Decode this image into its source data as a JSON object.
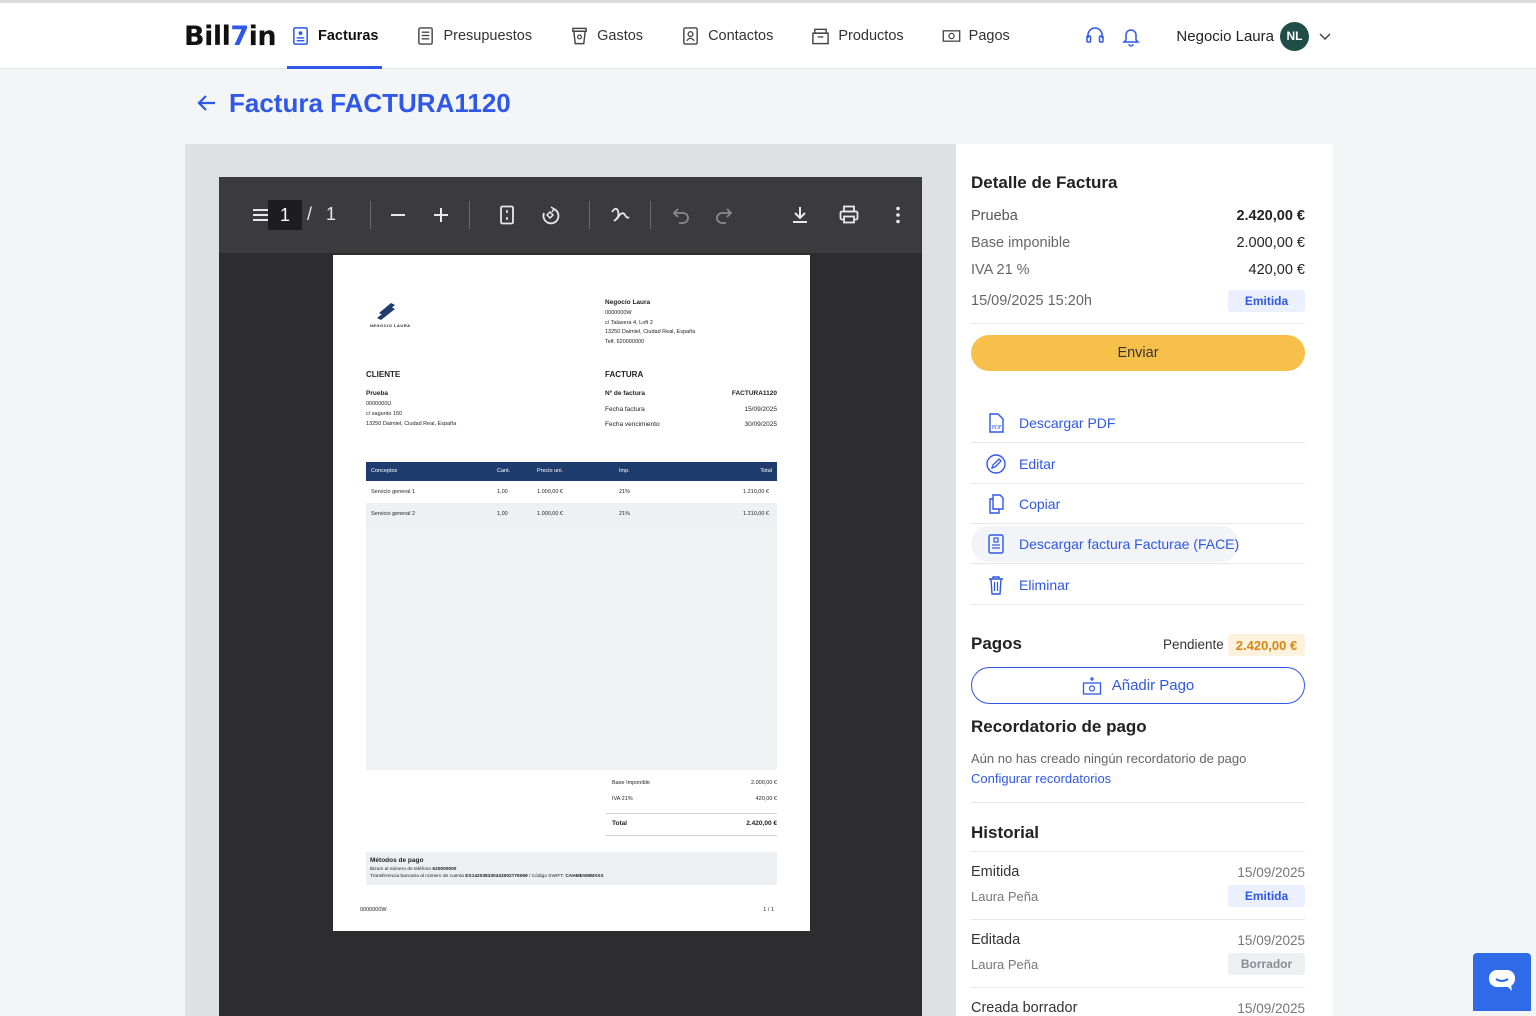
{
  "brand": {
    "logo_pre": "Bill",
    "logo_mid": "7",
    "logo_post": "in"
  },
  "nav": [
    {
      "label": "Facturas",
      "active": true
    },
    {
      "label": "Presupuestos"
    },
    {
      "label": "Gastos"
    },
    {
      "label": "Contactos"
    },
    {
      "label": "Productos"
    },
    {
      "label": "Pagos"
    }
  ],
  "user": {
    "name": "Negocio Laura",
    "initials": "NL"
  },
  "page": {
    "title": "Factura FACTURA1120"
  },
  "viewer": {
    "page_current": "1",
    "page_sep": "/",
    "page_total": "1"
  },
  "invoice_doc": {
    "logo_text": "NEGOCIO LAURA",
    "issuer": {
      "name": "Negocio Laura",
      "nif": "0000000W",
      "addr1": "c/ Talavera 4, Loft 2",
      "addr2": "13250 Daimiel, Ciudad Real, España",
      "tel": "Telf. 620000000"
    },
    "client_heading": "CLIENTE",
    "client": {
      "name": "Prueba",
      "nif": "0000000U",
      "addr1": "c/ sagunto 150",
      "addr2": "13250 Daimiel, Ciudad Real, España"
    },
    "invoice_heading": "FACTURA",
    "fields": [
      {
        "label": "Nº de factura",
        "value": "FACTURA1120"
      },
      {
        "label": "Fecha factura",
        "value": "15/09/2025"
      },
      {
        "label": "Fecha vencimiento",
        "value": "30/09/2025"
      }
    ],
    "columns": [
      "Conceptos",
      "Cant.",
      "Precio uni.",
      "Imp.",
      "Total"
    ],
    "rows": [
      [
        "Servicio general 1",
        "1,00",
        "1.000,00 €",
        "21%",
        "1.210,00 €"
      ],
      [
        "Servicio general 2",
        "1,00",
        "1.000,00 €",
        "21%",
        "1.210,00 €"
      ]
    ],
    "totals": [
      {
        "label": "Base Imponible",
        "value": "2.000,00 €"
      },
      {
        "label": "IVA 21%",
        "value": "420,00 €"
      },
      {
        "label": "Total",
        "value": "2.420,00 €"
      }
    ],
    "pay_heading": "Métodos de pago",
    "pay_line1_pre": "Bizum al número de teléfono ",
    "pay_line1_val": "620000000",
    "pay_line2_pre": "Transferencia bancaria al número de cuenta ",
    "pay_line2_iban": "ES1420383304330027760​69",
    "pay_line2_mid": " / Código SWIFT: ",
    "pay_line2_swift": "CAHMESMMXXX",
    "footer_left": "0000000W",
    "footer_right": "1 / 1"
  },
  "detail": {
    "heading": "Detalle de Factura",
    "client_label": "Prueba",
    "client_total": "2.420,00 €",
    "base_label": "Base imponible",
    "base_value": "2.000,00 €",
    "iva_label": "IVA 21 %",
    "iva_value": "420,00 €",
    "datetime": "15/09/2025 15:20h",
    "status": "Emitida",
    "send_label": "Enviar"
  },
  "actions": [
    {
      "label": "Descargar PDF",
      "icon": "pdf-icon"
    },
    {
      "label": "Editar",
      "icon": "edit-icon"
    },
    {
      "label": "Copiar",
      "icon": "copy-icon"
    },
    {
      "label": "Descargar factura Facturae (FACE)",
      "icon": "document-icon"
    },
    {
      "label": "Eliminar",
      "icon": "trash-icon"
    }
  ],
  "payments": {
    "heading": "Pagos",
    "pending_label": "Pendiente",
    "pending_value": "2.420,00 €",
    "add_label": "Añadir Pago"
  },
  "reminders": {
    "heading": "Recordatorio de pago",
    "empty_text": "Aún no has creado ningún recordatorio de pago",
    "config_link": "Configurar recordatorios"
  },
  "history": {
    "heading": "Historial",
    "items": [
      {
        "event": "Emitida",
        "date": "15/09/2025",
        "user": "Laura Peña",
        "badge": "Emitida",
        "badge_type": "blue"
      },
      {
        "event": "Editada",
        "date": "15/09/2025",
        "user": "Laura Peña",
        "badge": "Borrador",
        "badge_type": "grey"
      },
      {
        "event": "Creada borrador",
        "date": "15/09/2025"
      }
    ]
  },
  "colors": {
    "accent": "#2f57e8",
    "send": "#f6c04a",
    "table_head": "#1f3c6e",
    "avatar": "#1f4d47"
  }
}
